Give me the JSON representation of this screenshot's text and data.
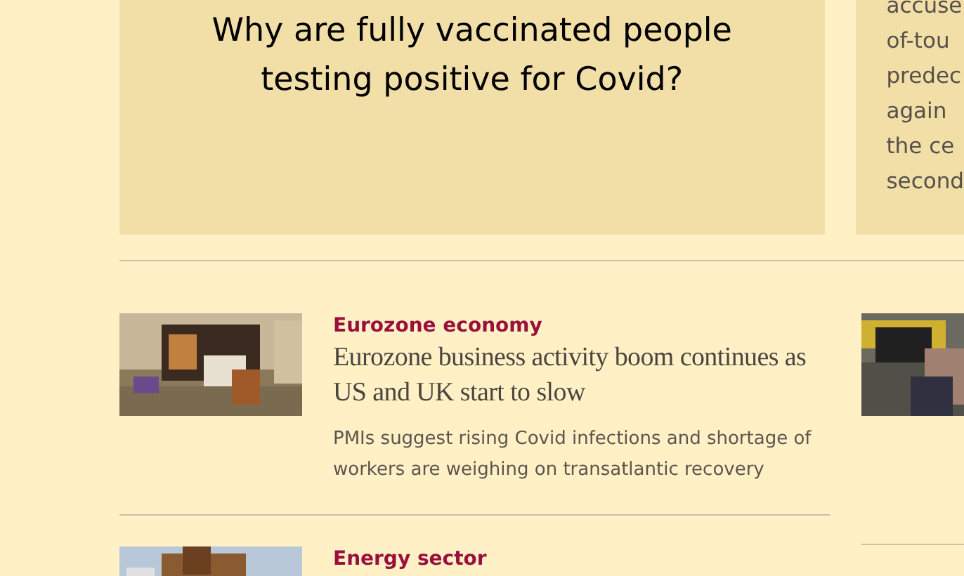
{
  "top_cards": [
    {
      "headline": "Why are fully vaccinated people testing positive for Covid?"
    },
    {
      "lines": [
        "accuse",
        "of-tou",
        "predec",
        "again",
        "the ce",
        "second"
      ]
    }
  ],
  "stories": [
    {
      "topic": "Eurozone economy",
      "headline": "Eurozone business activity boom continues as US and UK start to slow",
      "standfirst": "PMIs suggest rising Covid infections and shortage of workers are weighing on transatlantic recovery",
      "kind": "picture"
    },
    {
      "topic": "Energy sector",
      "kind": "picture"
    }
  ]
}
